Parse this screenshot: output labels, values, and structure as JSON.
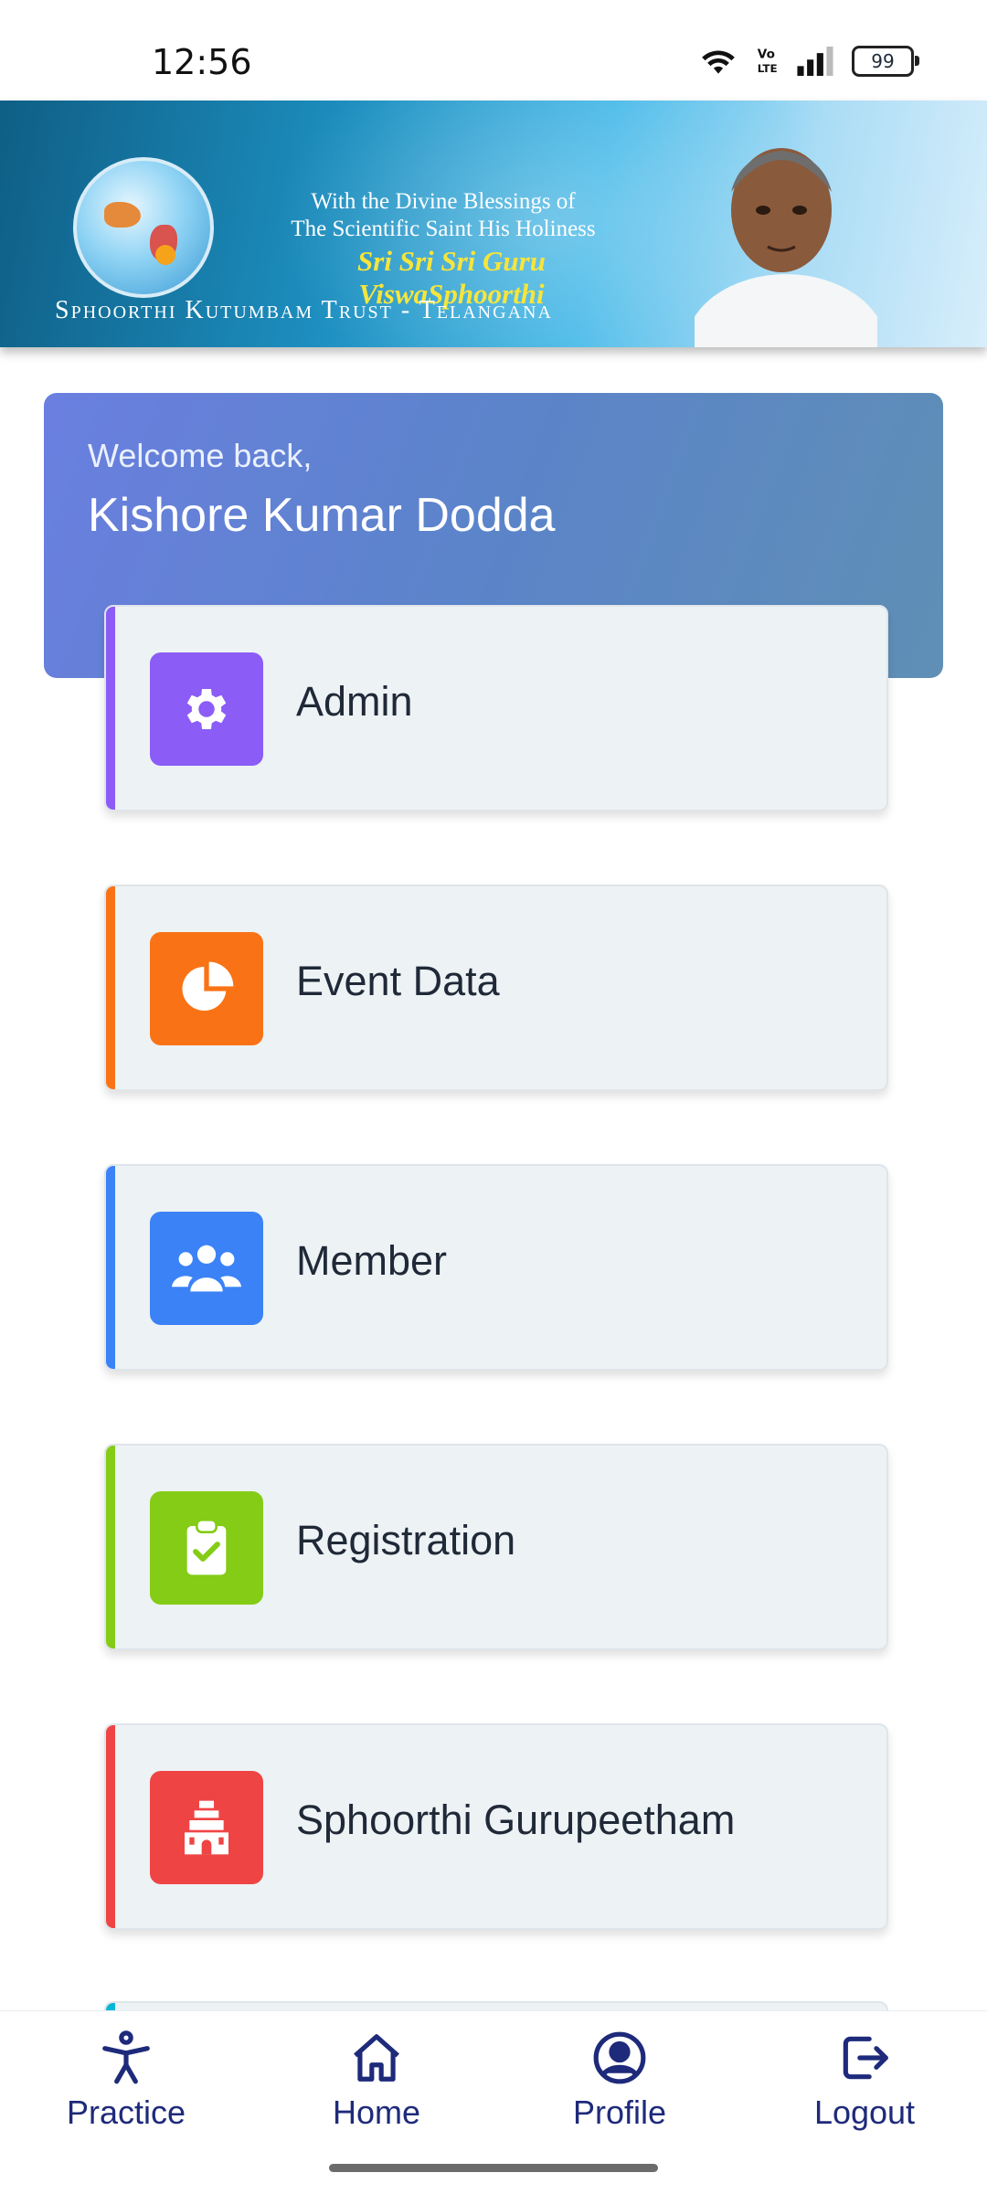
{
  "status_bar": {
    "time": "12:56",
    "battery": "99",
    "icons": [
      "moon-icon",
      "wifi-icon",
      "volte-icon",
      "signal-icon",
      "battery-icon"
    ]
  },
  "banner": {
    "blessing_line1": "With the Divine Blessings of",
    "blessing_line2": "The Scientific Saint His Holiness",
    "guru": "Sri Sri Sri Guru ViswaSphoorthi",
    "trust": "Sphoorthi Kutumbam Trust - Telangana"
  },
  "welcome": {
    "label": "Welcome back,",
    "name": "Kishore Kumar Dodda"
  },
  "menu": [
    {
      "label": "Admin",
      "icon": "gear-icon",
      "color": "#8b5cf6"
    },
    {
      "label": "Event Data",
      "icon": "pie-chart-icon",
      "color": "#f97316"
    },
    {
      "label": "Member",
      "icon": "users-icon",
      "color": "#3b82f6"
    },
    {
      "label": "Registration",
      "icon": "clipboard-check-icon",
      "color": "#84cc16"
    },
    {
      "label": "Sphoorthi Gurupeetham",
      "icon": "temple-icon",
      "color": "#ef4444"
    }
  ],
  "bottom_nav": {
    "practice": "Practice",
    "home": "Home",
    "profile": "Profile",
    "logout": "Logout",
    "accent_color": "#1e2a7a"
  }
}
